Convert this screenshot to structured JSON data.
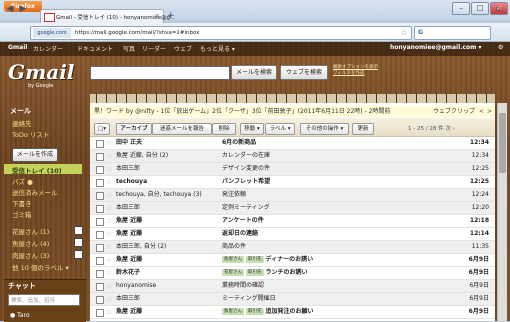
{
  "window": {
    "firefox_label": "Firefox",
    "tab_title": "Gmail - 受信トレイ (10) - honyanomiee@g...",
    "tab_close": "×",
    "new_tab": "+",
    "win_min": "–",
    "win_max": "□",
    "win_close": "×"
  },
  "navbar": {
    "back": "◀",
    "forward": "▶",
    "site_identity": "google.com",
    "url": "https://mail.google.com/mail/?shva=1#inbox",
    "star": "☆",
    "search_engine": "G",
    "home": "⌂",
    "menu": "≡"
  },
  "gbar": {
    "items": [
      "Gmail",
      "カレンダー",
      "ドキュメント",
      "写真",
      "リーダー",
      "ウェブ",
      "もっと見る ▾"
    ],
    "user": "honyanomiee@gmail.com ▾",
    "gear": "⚙"
  },
  "logo": {
    "text": "Gmail",
    "sub": "by Google"
  },
  "search": {
    "mail_button": "メールを検索",
    "web_button": "ウェブを検索",
    "options": [
      "検索オプションを表示",
      "フィルタを作成"
    ]
  },
  "nav": {
    "mail": "メール",
    "contacts": "連絡先",
    "tasks": "ToDo リスト",
    "compose": "メールを作成",
    "inbox": "受信トレイ (10)",
    "buzz": "バズ ●",
    "sent": "送信済みメール",
    "drafts": "下書き",
    "trash": "ゴミ箱",
    "label1": "花屋さん (1)",
    "label2": "魚屋さん (4)",
    "label3": "肉屋さん (3)",
    "more_labels": "他 10 個のラベル ▾"
  },
  "chat": {
    "title": "チャット",
    "placeholder": "検索、追加、招待",
    "user": "● Taro"
  },
  "ticker": {
    "text": "黒！ワード by @nifty - 1位「放出ゲーム」2位「クーザ」3位「前田敦子」(2011年6月11日 22時) - 2時間前",
    "right": "ウェブクリップ",
    "nav_prev": "<",
    "nav_next": ">"
  },
  "toolbar": {
    "select": "□▾",
    "archive": "アーカイブ",
    "spam": "迷惑メールを報告",
    "delete": "削除",
    "move": "移動 ▾",
    "label": "ラベル ▾",
    "more": "その他の操作 ▾",
    "refresh": "更新",
    "pager": "1 - 25 / 28 件  次 ›"
  },
  "emails": [
    {
      "sender": "田中 正夫",
      "subject": "6月の新商品",
      "labels": [],
      "time": "12:34",
      "unread": true
    },
    {
      "sender": "魚屋 近藤, 自分 (2)",
      "subject": "カレンダーの在庫",
      "labels": [],
      "time": "12:34",
      "unread": false
    },
    {
      "sender": "本田三郎",
      "subject": "デザイン変更の件",
      "labels": [],
      "time": "12:25",
      "unread": false
    },
    {
      "sender": "techouya",
      "subject": "パンフレット希望",
      "labels": [],
      "time": "12:25",
      "unread": true
    },
    {
      "sender": "techouya, 自分, techouya (3)",
      "subject": "発注依頼",
      "labels": [],
      "time": "12:24",
      "unread": false
    },
    {
      "sender": "本田三郎",
      "subject": "定例ミーティング",
      "labels": [],
      "time": "12:20",
      "unread": false
    },
    {
      "sender": "魚屋 近藤",
      "subject": "アンケートの件",
      "labels": [],
      "time": "12:18",
      "unread": true
    },
    {
      "sender": "魚屋 近藤",
      "subject": "返却日の連絡",
      "labels": [],
      "time": "12:14",
      "unread": true
    },
    {
      "sender": "本田三郎, 自分 (2)",
      "subject": "商品の件",
      "labels": [],
      "time": "11:35",
      "unread": false
    },
    {
      "sender": "魚屋 近藤",
      "subject": "ディナーのお誘い",
      "labels": [
        "魚屋さん",
        "取引先"
      ],
      "time": "6月9日",
      "unread": true
    },
    {
      "sender": "鈴木花子",
      "subject": "ランチのお誘い",
      "labels": [
        "花屋さん",
        "取引先"
      ],
      "time": "6月9日",
      "unread": true
    },
    {
      "sender": "honyanomise",
      "subject": "業務時間の確認",
      "labels": [],
      "time": "6月9日",
      "unread": false
    },
    {
      "sender": "本田三郎",
      "subject": "ミーティング開催日",
      "labels": [],
      "time": "6月9日",
      "unread": false
    },
    {
      "sender": "魚屋 近藤",
      "subject": "追加発注のお願い",
      "labels": [
        "魚屋さん",
        "取引先"
      ],
      "time": "6月9日",
      "unread": true
    }
  ]
}
